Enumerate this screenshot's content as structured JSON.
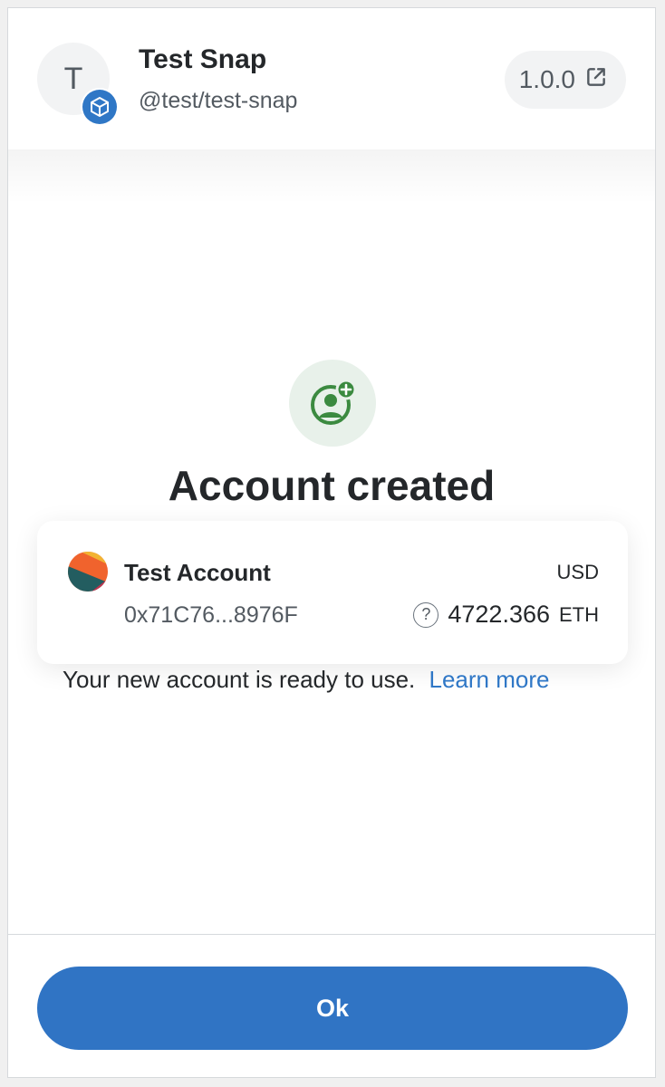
{
  "header": {
    "avatar_letter": "T",
    "snap_name": "Test Snap",
    "snap_id": "@test/test-snap",
    "version": "1.0.0",
    "badge_icon": "cube-icon",
    "version_icon": "external-link-icon"
  },
  "result": {
    "icon": "user-add-icon",
    "title": "Account created"
  },
  "account": {
    "name": "Test Account",
    "address": "0x71C76...8976F",
    "currency": "USD",
    "balance": "4722.366",
    "unit": "ETH",
    "help_symbol": "?"
  },
  "message": {
    "text": "Your new account is ready to use.",
    "link": "Learn more"
  },
  "footer": {
    "ok_label": "Ok"
  },
  "colors": {
    "accent": "#3074c4",
    "success": "#3b8a40",
    "success_bg": "#e8f1ea"
  }
}
